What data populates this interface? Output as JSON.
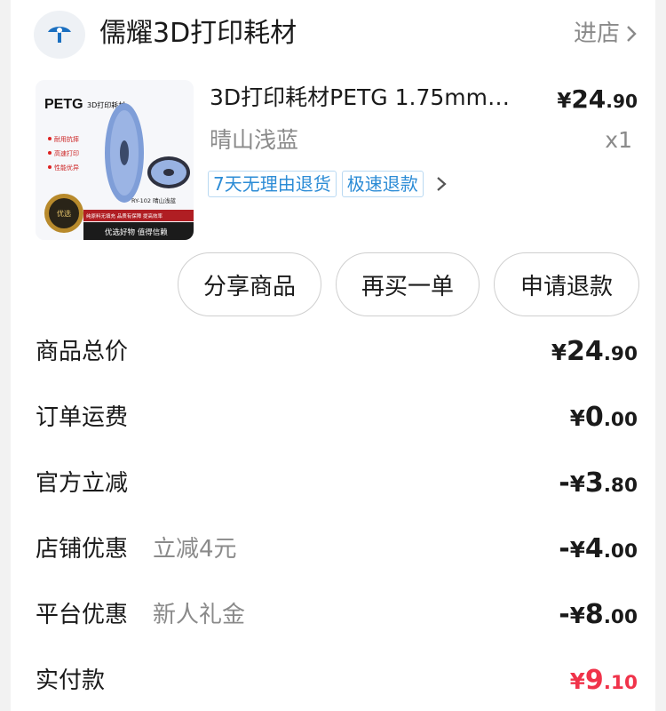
{
  "shop": {
    "name": "儒耀3D打印耗材",
    "enter_label": "进店"
  },
  "product": {
    "title": "3D打印耗材PETG 1.75mm…",
    "variant": "晴山浅蓝",
    "quantity": "x1",
    "price": {
      "yen": "¥",
      "int": "24",
      "dec": ".90"
    },
    "tags": [
      "7天无理由退货",
      "极速退款"
    ],
    "image_text": {
      "brand": "PETG",
      "subtitle": "3D打印耗材",
      "features": [
        "耐用抗摔",
        "高速打印",
        "性能优异"
      ],
      "model": "RY-102 晴山浅蓝",
      "banner": "纯原料无填充 品质有保障 提高效率",
      "footer": "优选好物 值得信赖",
      "seal": "优选"
    }
  },
  "actions": {
    "share": "分享商品",
    "rebuy": "再买一单",
    "refund": "申请退款"
  },
  "fees": [
    {
      "label": "商品总价",
      "sub": "",
      "sign": "",
      "int": "24",
      "dec": ".90"
    },
    {
      "label": "订单运费",
      "sub": "",
      "sign": "",
      "int": "0",
      "dec": ".00"
    },
    {
      "label": "官方立减",
      "sub": "",
      "sign": "-",
      "int": "3",
      "dec": ".80"
    },
    {
      "label": "店铺优惠",
      "sub": "立减4元",
      "sign": "-",
      "int": "4",
      "dec": ".00"
    },
    {
      "label": "平台优惠",
      "sub": "新人礼金",
      "sign": "-",
      "int": "8",
      "dec": ".00"
    }
  ],
  "paid": {
    "label": "实付款",
    "yen": "¥",
    "int": "9",
    "dec": ".10",
    "color": "#f0334a"
  },
  "colors": {
    "tag_blue": "#2c8cd6",
    "text": "#1a1a1a",
    "muted": "#8a8a8a"
  }
}
